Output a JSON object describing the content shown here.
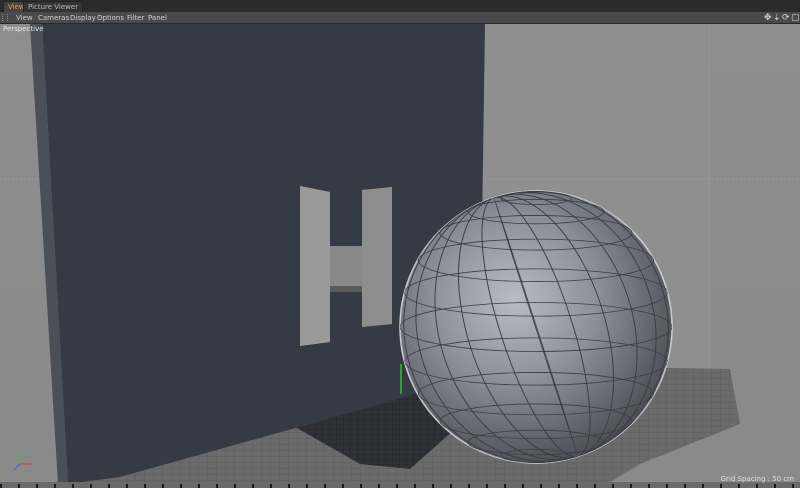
{
  "tabs": [
    {
      "label": "View",
      "active": true
    },
    {
      "label": "Picture Viewer",
      "active": false
    }
  ],
  "menu": [
    "View",
    "Cameras",
    "Display",
    "Options",
    "Filter",
    "Panel"
  ],
  "nav_icons": [
    "move-icon",
    "zoom-icon",
    "rotate-icon",
    "maximize-icon"
  ],
  "viewport": {
    "camera_label": "Perspective",
    "grid_spacing_label": "Grid Spacing : 50 cm",
    "wall_letter": "H"
  },
  "colors": {
    "accent": "#e6a23a",
    "wall": "#353b44",
    "floor": "#6f6f6f",
    "sky": "#8c8c8c",
    "sphere": "#8a8d95"
  }
}
